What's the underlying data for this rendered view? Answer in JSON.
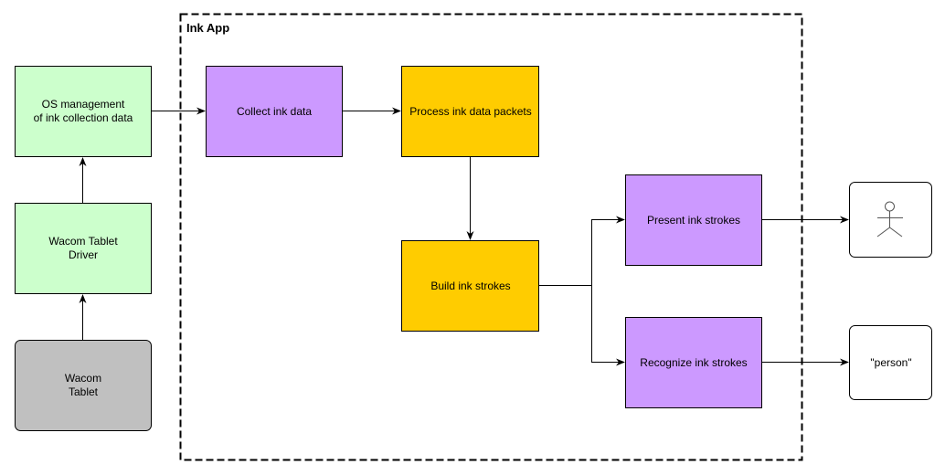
{
  "container": {
    "title": "Ink App"
  },
  "colors": {
    "os": "#ccffcc",
    "app_purple": "#cc99ff",
    "app_gold": "#ffcc00",
    "hardware": "#c0c0c0"
  },
  "nodes": {
    "os": [
      "OS management",
      "of ink collection data"
    ],
    "driver": [
      "Wacom Tablet",
      "Driver"
    ],
    "tablet": [
      "Wacom",
      "Tablet"
    ],
    "collect": [
      "Collect ink data"
    ],
    "process": [
      "Process ink data packets"
    ],
    "build": [
      "Build ink strokes"
    ],
    "present": [
      "Present ink strokes"
    ],
    "recognize": [
      "Recognize ink strokes"
    ],
    "output_text": [
      "\"person\""
    ]
  },
  "icons": {
    "output_actor": "stick-figure-icon"
  }
}
